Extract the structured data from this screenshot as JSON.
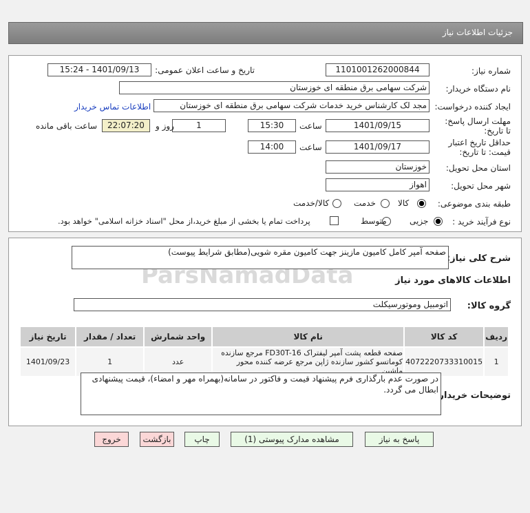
{
  "header": {
    "title": "جزئیات اطلاعات نیاز"
  },
  "form": {
    "need_number_label": "شماره نیاز:",
    "need_number": "1101001262000844",
    "announce_label": "تاریخ و ساعت اعلان عمومی:",
    "announce_value": "1401/09/13 - 15:24",
    "buyer_org_label": "نام دستگاه خریدار:",
    "buyer_org": "شرکت سهامی برق منطقه ای خوزستان",
    "creator_label": "ایجاد کننده درخواست:",
    "creator": "مجد لک کارشناس خرید خدمات شرکت سهامی برق منطقه ای خوزستان",
    "contact_link": "اطلاعات تماس خریدار",
    "deadline_label": "مهلت ارسال پاسخ: تا تاریخ:",
    "deadline_date": "1401/09/15",
    "time_label": "ساعت",
    "deadline_time": "15:30",
    "days": "1",
    "days_label": "روز و",
    "remaining": "22:07:20",
    "remaining_label": "ساعت باقی مانده",
    "validity_label": "حداقل تاریخ اعتبار قیمت: تا تاریخ:",
    "validity_date": "1401/09/17",
    "validity_time": "14:00",
    "province_label": "استان محل تحویل:",
    "province": "خوزستان",
    "city_label": "شهر محل تحویل:",
    "city": "اهواز",
    "category_label": "طبقه بندی موضوعی:",
    "category_options": [
      "کالا",
      "خدمت",
      "کالا/خدمت"
    ],
    "category_selected": "کالا",
    "process_label": "نوع فرآیند خرید :",
    "process_options": [
      "جزیی",
      "متوسط"
    ],
    "process_selected": "جزیی",
    "payment_note": "پرداخت تمام یا بخشی از مبلغ خرید،از محل \"اسناد خزانه اسلامی\" خواهد بود."
  },
  "details": {
    "summary_label": "شرح کلی نیاز:",
    "summary": "صفحه آمپر کامل کامیون مازینز جهت کامیون مقره شویی(مطابق شرایط پیوست)",
    "goods_title": "اطلاعات کالاهای مورد نیاز",
    "group_label": "گروه کالا:",
    "group": "اتومبیل وموتورسیکلت",
    "table": {
      "headers": [
        "ردیف",
        "کد کالا",
        "نام کالا",
        "واحد شمارش",
        "تعداد / مقدار",
        "تاریخ نیاز"
      ],
      "rows": [
        [
          "1",
          "4072220733310015",
          "صفحه قطعه پشت آمپر لیفتراک FD30T-16 مرجع سازنده کوماتسو کشور سازنده ژاپن مرجع عرضه کننده محور ماشین",
          "عدد",
          "1",
          "1401/09/23"
        ]
      ]
    },
    "notes_label": "توضیحات خریدار:",
    "notes": "در صورت عدم بارگذاری فرم پیشنهاد قیمت و فاکتور در سامانه(بهمراه مهر و امضاء)، قیمت پیشنهادی ابطال می گردد."
  },
  "buttons": {
    "reply": "پاسخ به نیاز",
    "docs": "مشاهده مدارک پیوستی (1)",
    "print": "چاپ",
    "back": "بازگشت",
    "exit": "خروج"
  },
  "watermark": "ParsNamadData"
}
